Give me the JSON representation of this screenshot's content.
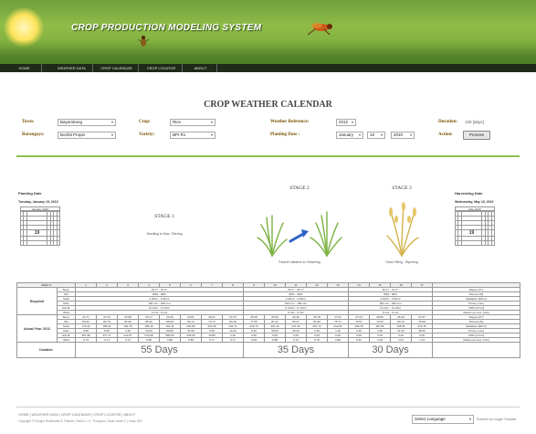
{
  "header": {
    "title": "CROP PRODUCTION MODELING SYSTEM"
  },
  "nav": [
    "HOME",
    "WEATHER DATA",
    "CROP CALENDAR",
    "CROP LOCATOR",
    "ABOUT"
  ],
  "page_title": "CROP WEATHER CALENDAR",
  "form": {
    "town_label": "Town:",
    "town_value": "Bayombong",
    "barangays_label": "Barangays:",
    "barangays_value": "Bonfal Proper",
    "crop_label": "Crop:",
    "crop_value": "Rice",
    "variety_label": "Variety:",
    "variety_value": "BPI R1",
    "weather_ref_label": "Weather Reference:",
    "weather_ref_value": "2012",
    "planting_date_label": "Planting Date :",
    "planting_month": "January",
    "planting_day": "19",
    "planting_year": "2010",
    "duration_label": "Duration:",
    "duration_value": "120 [days]",
    "action_label": "Action:",
    "process_label": "Process"
  },
  "planting": {
    "heading": "Planting Date",
    "date_text": "Tuesday, January 19, 2010",
    "month_label": "January 2010",
    "highlight": "19"
  },
  "harvesting": {
    "heading": "Harvesting Date",
    "date_text": "Wednesday, May 19, 2010",
    "month_label": "May 2010",
    "highlight": "19"
  },
  "stages": {
    "s1_label": "STAGE 1",
    "s1_caption": "Seedling to Max. Tillering",
    "s2_label": "STAGE 2",
    "s2_caption": "Panicle Initiation to Flowering",
    "s3_label": "STAGE 3",
    "s3_caption": "Grain Filling - Ripening"
  },
  "table": {
    "week_header": "WEEK #",
    "weeks": [
      "1",
      "2",
      "3",
      "4",
      "5",
      "6",
      "7",
      "8",
      "9",
      "10",
      "11",
      "12",
      "13",
      "14",
      "15",
      "16",
      "17"
    ],
    "required_label": "Required",
    "actual_label": "Actual Year: 2012",
    "duration_label": "Duration",
    "param_codes": [
      "Temp.",
      "RH",
      "Solar",
      "Rain",
      "Soil M.",
      "Wind"
    ],
    "units": [
      "Degree [C°]",
      "Percent [%]",
      "Radiation [W/m²]",
      "Precip. [mm]",
      "VWC [m³/m³]",
      "Meters per sec. [m/s]"
    ],
    "req_stage1": [
      "26 C° - 31 C°",
      "80% - 90%",
      "2 W/m² - 3 W/m²",
      "100 mm - 180 mm",
      "0 m³/m³ - 0 m³/m³",
      "0 m/s - 0 m/s"
    ],
    "req_stage2": [
      "26 C° - 31 C°",
      "80% - 90%",
      "2 W/m² - 3 W/m²",
      "100 mm - 180 mm",
      "0 m³/m³ - 0 m³/m³",
      "0 m/s - 0 m/s"
    ],
    "req_stage3": [
      "26 C° - 31 C°",
      "80% - 90%",
      "2 W/m² - 3 W/m²",
      "100 mm - 180 mm",
      "0 m³/m³ - 0 m³/m³",
      "0 m/s - 0 m/s"
    ],
    "actual_rows": [
      [
        "23.71",
        "23.79",
        "22.98",
        "23.17",
        "23.20",
        "24.81",
        "25.01",
        "24.75",
        "25.68",
        "25.99",
        "26.30",
        "25.78",
        "27.61",
        "27.23",
        "28.65",
        "26.29",
        "27.67"
      ],
      [
        "80.93",
        "84.79",
        "81.69",
        "85.46",
        "89.09",
        "80.14",
        "74.74",
        "83.49",
        "77.05",
        "87.11",
        "80.37",
        "81.90",
        "75.71",
        "70.57",
        "73.03",
        "80.16",
        "75.08"
      ],
      [
        "179.32",
        "180.31",
        "194.79",
        "186.16",
        "161.31",
        "204.89",
        "261.59",
        "234.74",
        "219.79",
        "261.44",
        "247.40",
        "257.73",
        "413.00",
        "405.78",
        "487.86",
        "448.86",
        "415.15"
      ],
      [
        "9.80",
        "8.60",
        "1.60",
        "20.00",
        "60.80",
        "31.80",
        "9.60",
        "14.20",
        "6.20",
        "99.60",
        "25.20",
        "1.60",
        "1.20",
        "3.20",
        "1.80",
        "21.60",
        "38.60"
      ],
      [
        "367.08",
        "317.71",
        "313.57",
        "570.08",
        "584.90",
        "266.30",
        "10.86",
        "2.26",
        "0.00",
        "0.00",
        "0.00",
        "0.00",
        "0.00",
        "0.00",
        "0.00",
        "0.00",
        "0.00"
      ],
      [
        "0.73",
        "0.71",
        "0.74",
        "0.68",
        "0.86",
        "0.89",
        "0.77",
        "0.71",
        "0.63",
        "0.88",
        "0.74",
        "0.76",
        "0.80",
        "0.91",
        "1.09",
        "1.07",
        "1.13"
      ]
    ],
    "durations": [
      "55 Days",
      "35 Days",
      "30 Days"
    ]
  },
  "footer": {
    "links": "HOME | WEATHER DATA | CROP CALENDAR | CROP LOCATOR | ABOUT",
    "copyright": "Copyright © Rongie Rodemalis B. Patricio, Pablo U. G. Thongson, Dean Hazel V. | Vista, BSI",
    "language_label": "Select Language",
    "powered_by": "Powered by Google Translate"
  }
}
